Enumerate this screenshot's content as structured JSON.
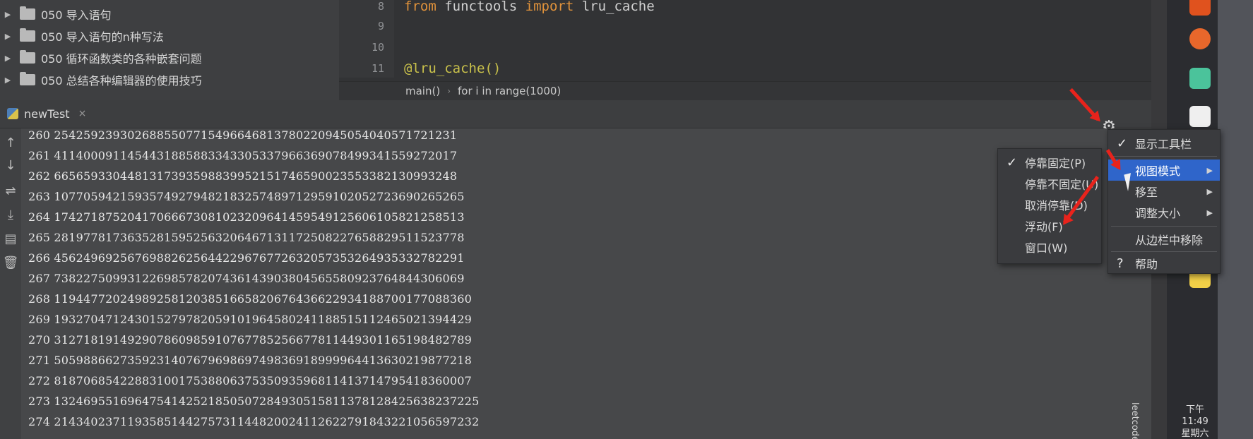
{
  "project_tree": [
    "050 导入语句",
    "050 导入语句的n种写法",
    "050 循环函数类的各种嵌套问题",
    "050 总结各种编辑器的使用技巧"
  ],
  "editor": {
    "lines": [
      {
        "num": "8"
      },
      {
        "num": "9"
      },
      {
        "num": "10"
      },
      {
        "num": "11"
      }
    ],
    "code_line_8": {
      "kw1": "from",
      "module": "functools",
      "kw2": "import",
      "name": "lru_cache"
    },
    "code_line_11": "@lru_cache()",
    "breadcrumbs": [
      "main()",
      "for i in range(1000)"
    ]
  },
  "run_window": {
    "tab_label": "newTest",
    "output": [
      "260 2542592393026885507715496646813780220945054040571721231",
      "261 4114000911454431885883343305337966369078499341559272017",
      "262 6656593304481317393598839952151746590023553382130993248",
      "263 1077059421593574927948218325748971295910205272369026​5265",
      "264 1742718752041706667308102320964145954912560610582125​8513",
      "265 2819778173635281595256320646713117250822765882951152​3778",
      "266 4562496925676988262564422967677263205735326493533278​2291",
      "267 7382275099312269857820743614390380456558092376484430​6069",
      "268 1194477202498925812038516658206764366229341887001770​88360",
      "269 1932704712430152797820591019645802411885151124650213​94429",
      "270 3127181914929078609859107677852566778114493011651984​82789",
      "271 5059886627359231407679698697498369189999644136302198​77218",
      "272 8187068542288310017538806375350935968114137147954183​60007",
      "273 1324695516964754142521850507284930515811378128425638​237225",
      "274 2143402371193585144275731144820024112622791843221056​597232"
    ]
  },
  "gear_menu": [
    "显示工具栏",
    "视图模式",
    "移至",
    "调整大小",
    "从边栏中移除",
    "帮助"
  ],
  "view_mode_submenu": [
    "停靠固定(P)",
    "停靠不固定(U)",
    "取消停靠(D)",
    "浮动(F)",
    "窗口(W)"
  ],
  "taskbar": {
    "time": "下午 11:49",
    "day": "星期六",
    "side_tab": "leetcode"
  }
}
